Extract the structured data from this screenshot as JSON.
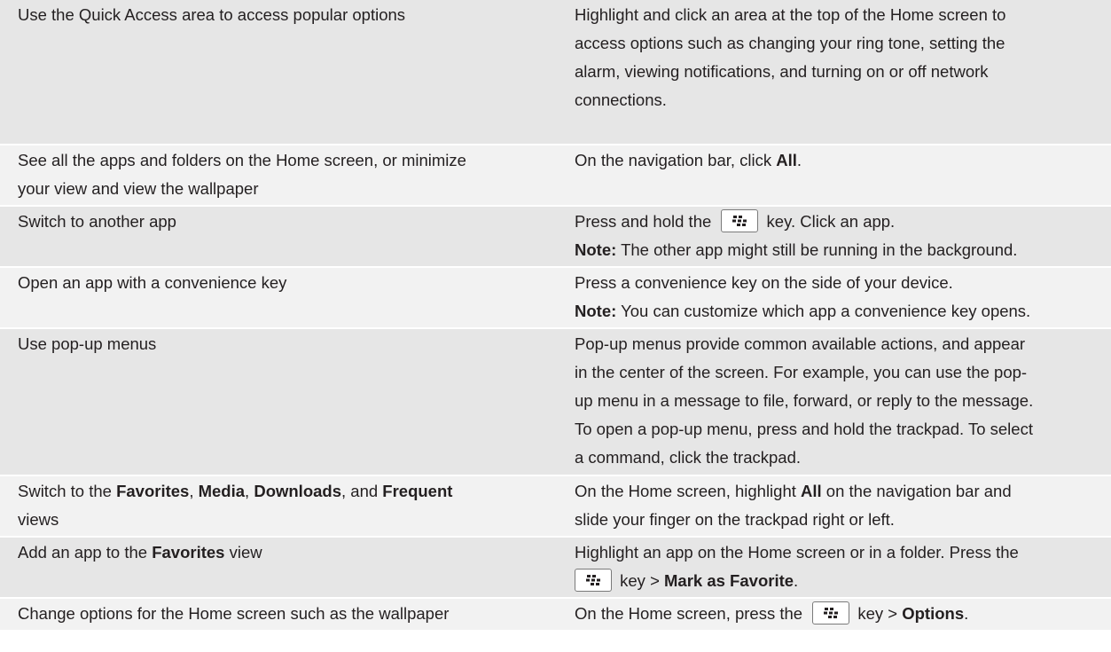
{
  "rows": [
    {
      "task": [
        "Use the Quick Access area to access popular options"
      ],
      "desc": [
        "Highlight and click an area at the top of the Home screen to",
        "access options such as changing your ring tone, setting the",
        "alarm, viewing notifications, and turning on or off network",
        "connections."
      ]
    },
    {
      "task": [
        "See all the apps and folders on the Home screen, or minimize",
        "your view and view the wallpaper"
      ],
      "desc": {
        "prefix": "On the navigation bar, click ",
        "bold": "All",
        "suffix": "."
      }
    },
    {
      "task": "Switch to another app",
      "desc": {
        "prefix": "Press and hold the ",
        "suffix": " key. Click an app.",
        "note_label": "Note:",
        "note_text": " The other app might still be running in the background."
      }
    },
    {
      "task": "Open an app with a convenience key",
      "desc": {
        "line": "Press a convenience key on the side of your device.",
        "note_label": "Note:",
        "note_text": " You can customize which app a convenience key opens."
      }
    },
    {
      "task": "Use pop-up menus",
      "desc": [
        "Pop-up menus provide common available actions, and appear",
        "in the center of the screen. For example, you can use the pop-",
        "up menu in a message to file, forward, or reply to the message.",
        "To open a pop-up menu, press and hold the trackpad. To select",
        "a command, click the trackpad."
      ]
    },
    {
      "task": {
        "t1": "Switch to the ",
        "b1": "Favorites",
        "t2": ", ",
        "b2": "Media",
        "t3": ", ",
        "b3": "Downloads",
        "t4": ", and ",
        "b4": "Frequent",
        "t5": "views"
      },
      "desc": {
        "prefix": "On the Home screen, highlight ",
        "bold": "All",
        "mid": " on the navigation bar and",
        "line2": "slide your finger on the trackpad right or left."
      }
    },
    {
      "task": {
        "prefix": "Add an app to the ",
        "bold": "Favorites",
        "suffix": " view"
      },
      "desc": {
        "line1": "Highlight an app on the Home screen or in a folder. Press the",
        "mid": " key > ",
        "bold": "Mark as Favorite",
        "suffix": "."
      }
    },
    {
      "task": "Change options for the Home screen such as the wallpaper",
      "desc": {
        "prefix": "On the Home screen, press the ",
        "mid": " key > ",
        "bold": "Options",
        "suffix": "."
      }
    }
  ],
  "icons": {
    "menu_key": "blackberry-menu-key-icon"
  }
}
